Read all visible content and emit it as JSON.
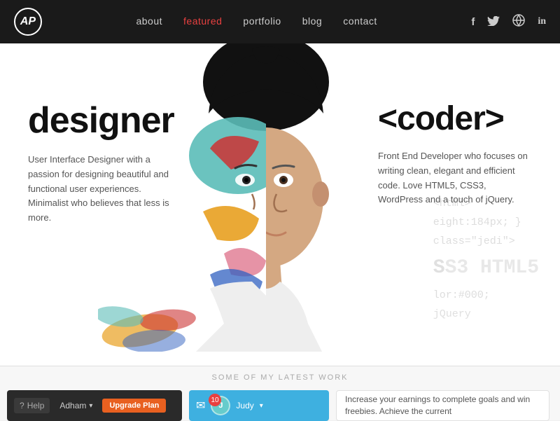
{
  "navbar": {
    "logo_text": "AP",
    "links": [
      {
        "label": "about",
        "active": false
      },
      {
        "label": "featured",
        "active": true
      },
      {
        "label": "portfolio",
        "active": false
      },
      {
        "label": "blog",
        "active": false
      },
      {
        "label": "contact",
        "active": false
      }
    ],
    "social": [
      {
        "name": "facebook",
        "symbol": "f"
      },
      {
        "name": "twitter",
        "symbol": "🐦"
      },
      {
        "name": "dribbble",
        "symbol": "⊕"
      },
      {
        "name": "linkedin",
        "symbol": "in"
      }
    ]
  },
  "hero": {
    "left_title": "designer",
    "left_desc": "User Interface Designer with a passion for designing beautiful and functional user experiences. Minimalist who believes that less is more.",
    "right_title": "<coder>",
    "right_desc": "Front End Developer who focuses on writing clean, elegant and efficient code. Love HTML5, CSS3, WordPress and a touch of jQuery.",
    "code_lines": [
      "<html>",
      "eight:184px;}",
      "class=\"jedi\">",
      "SS3 HTML5",
      "lor:#000;",
      "jQuery"
    ]
  },
  "bottom": {
    "section_title": "SOME OF MY LATEST WORK",
    "card1": {
      "help_label": "Help",
      "user_label": "Adham",
      "upgrade_label": "Upgrade Plan"
    },
    "card2": {
      "notif_count": "10",
      "user_name": "Judy"
    },
    "card3": {
      "text": "Increase your earnings to complete goals and win freebies. Achieve the current"
    }
  }
}
